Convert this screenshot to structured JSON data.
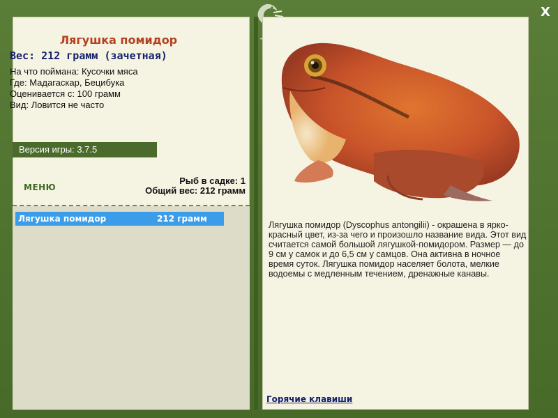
{
  "fish": {
    "name": "Лягушка помидор",
    "weight_line": "Вес: 212 грамм (зачетная)",
    "caught_on": "На что поймана: Кусочки мяса",
    "location": "Где: Мадагаскар, Бецибука",
    "valued_from": "Оценивается с: 100 грамм",
    "kind": "Вид: Ловится не часто",
    "description": "Лягушка помидор (Dyscophus antongilii) - окрашена в ярко-красный цвет, из-за чего и произошло название вида. Этот вид считается самой большой лягушкой-помидором. Размер — до 9 см у самок и до 6,5 см у самцов. Она активна в ночное время суток. Лягушка помидор населяет болота, мелкие водоемы с медленным течением, дренажные канавы."
  },
  "version": "Версия игры: 3.7.5",
  "menu_label": "МЕНЮ",
  "keepnet": {
    "count": "Рыб в садке: 1",
    "total": "Общий вес: 212 грамм"
  },
  "list": [
    {
      "name": "Лягушка помидор",
      "weight": "212 грамм"
    }
  ],
  "hotkeys": "Горячие клавиши",
  "close_label": "X",
  "colors": {
    "frame": "#4d6e2e",
    "panel": "#f5f3e2",
    "title": "#b5401f",
    "weight": "#16216b",
    "selection": "#3b9dea"
  }
}
